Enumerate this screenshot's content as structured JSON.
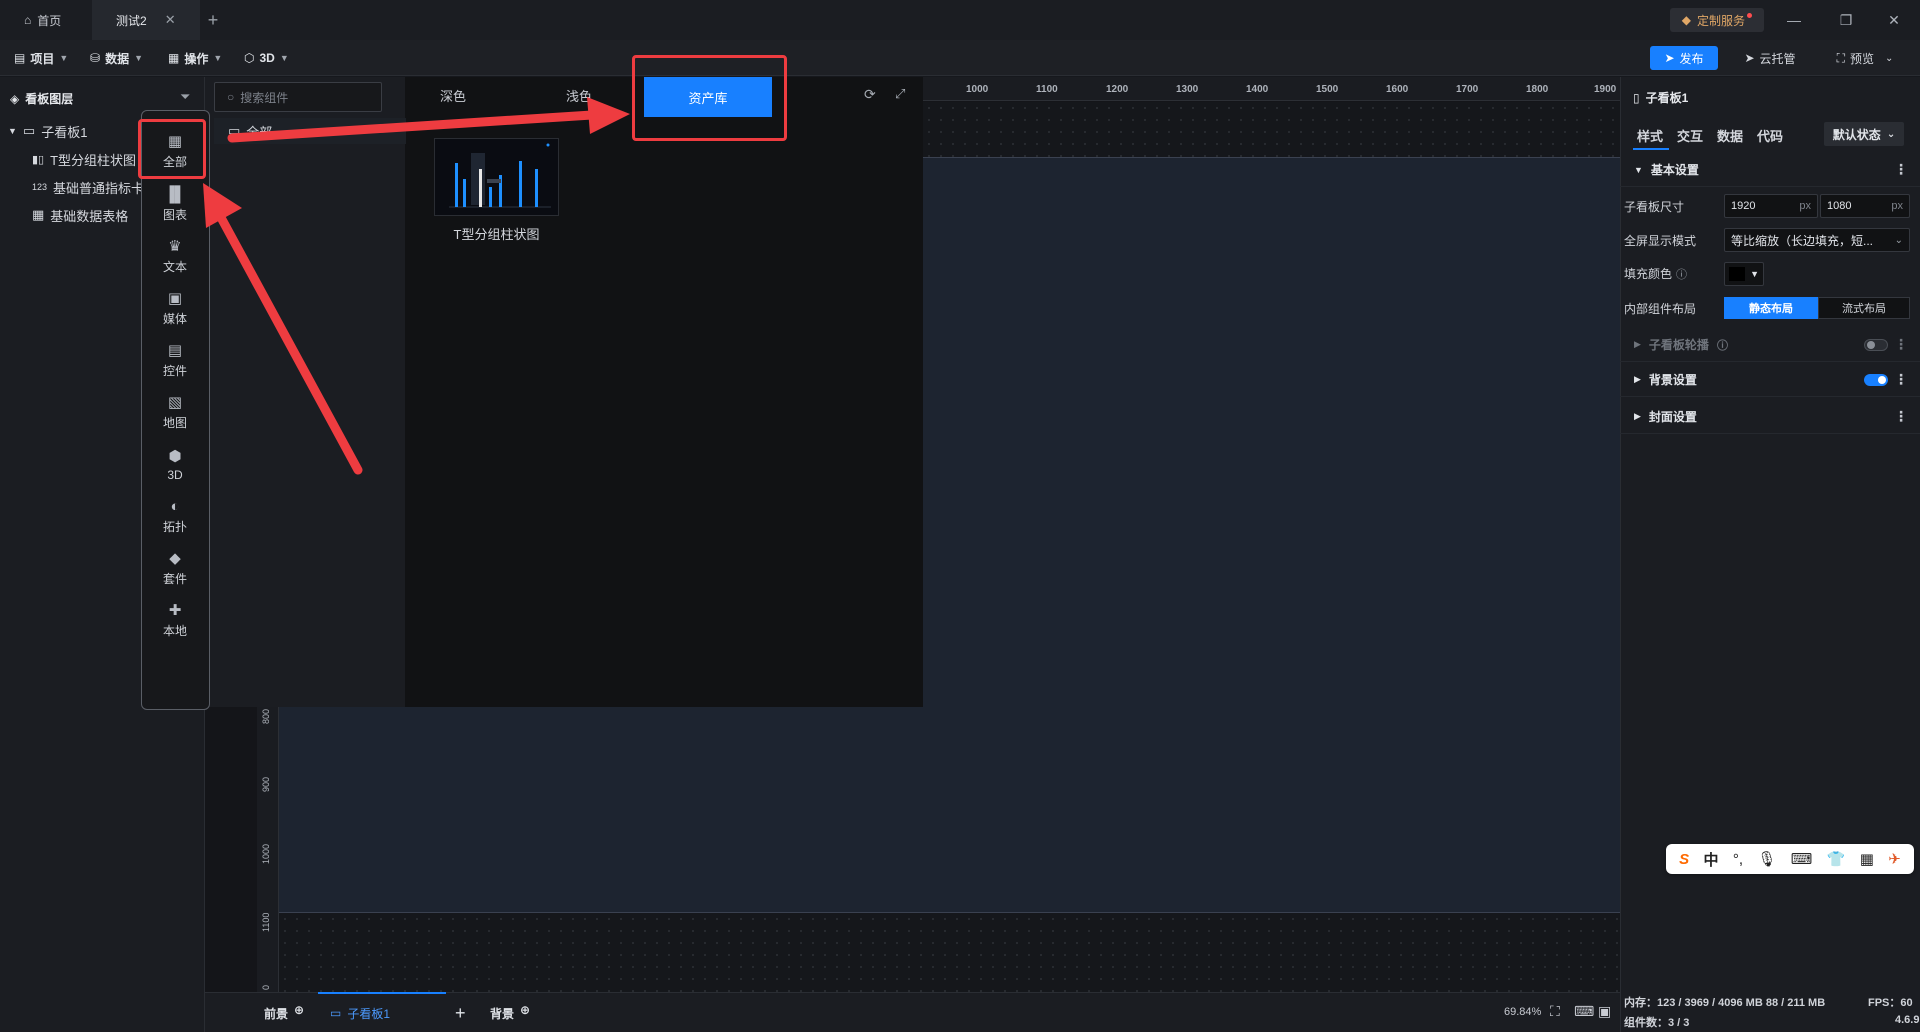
{
  "titlebar": {
    "tabs": [
      {
        "label": "首页"
      },
      {
        "label": "测试2"
      }
    ],
    "custom_service": "定制服务"
  },
  "menubar": {
    "items": [
      {
        "label": "项目"
      },
      {
        "label": "数据"
      },
      {
        "label": "操作"
      },
      {
        "label": "3D"
      }
    ],
    "publish": "发布",
    "cloud": "云托管",
    "preview": "预览"
  },
  "layers": {
    "title": "看板图层",
    "items": [
      {
        "label": "子看板1"
      },
      {
        "label": "T型分组柱状图"
      },
      {
        "label": "基础普通指标卡"
      },
      {
        "label": "基础数据表格"
      }
    ]
  },
  "popup": {
    "search_placeholder": "搜索组件",
    "categories": [
      {
        "label": "全部",
        "icon": "grid-icon"
      },
      {
        "label": "图表",
        "icon": "bar-chart-icon"
      },
      {
        "label": "文本",
        "icon": "text-icon"
      },
      {
        "label": "媒体",
        "icon": "media-icon"
      },
      {
        "label": "控件",
        "icon": "widget-icon"
      },
      {
        "label": "地图",
        "icon": "map-icon"
      },
      {
        "label": "3D",
        "icon": "cube-icon"
      },
      {
        "label": "拓扑",
        "icon": "topology-icon"
      },
      {
        "label": "套件",
        "icon": "kit-icon"
      },
      {
        "label": "本地",
        "icon": "puzzle-icon"
      }
    ],
    "folder": "全部",
    "tabs": {
      "dark": "深色",
      "light": "浅色",
      "assets": "资产库"
    },
    "asset": {
      "label": "T型分组柱状图"
    }
  },
  "ruler": {
    "top": [
      "1000",
      "1100",
      "1200",
      "1300",
      "1400",
      "1500",
      "1600",
      "1700",
      "1800",
      "1900"
    ],
    "left": [
      "800",
      "900",
      "1000",
      "1100",
      "0"
    ]
  },
  "bottom": {
    "front": "前景",
    "board": "子看板1",
    "back": "背景",
    "zoom": "69.84%"
  },
  "right_panel": {
    "title": "子看板1",
    "tabs": [
      "样式",
      "交互",
      "数据",
      "代码"
    ],
    "state": "默认状态",
    "sections": {
      "basic": "基本设置",
      "carousel": "子看板轮播",
      "background": "背景设置",
      "cover": "封面设置"
    },
    "fields": {
      "size_label": "子看板尺寸",
      "width": "1920",
      "height": "1080",
      "unit": "px",
      "fullscreen_label": "全屏显示模式",
      "fullscreen_value": "等比缩放（长边填充，短...",
      "fill_label": "填充颜色",
      "layout_label": "内部组件布局",
      "layout_static": "静态布局",
      "layout_flow": "流式布局"
    },
    "status": {
      "memory": "内存：123 / 3969 / 4096 MB  88 / 211 MB",
      "fps": "FPS：60",
      "count": "组件数：3 / 3",
      "version": "4.6.9"
    }
  },
  "ime": {
    "lang": "中"
  },
  "colors": {
    "accent": "#1880ff",
    "annotation": "#ee3c40",
    "board": "#1d2430"
  }
}
